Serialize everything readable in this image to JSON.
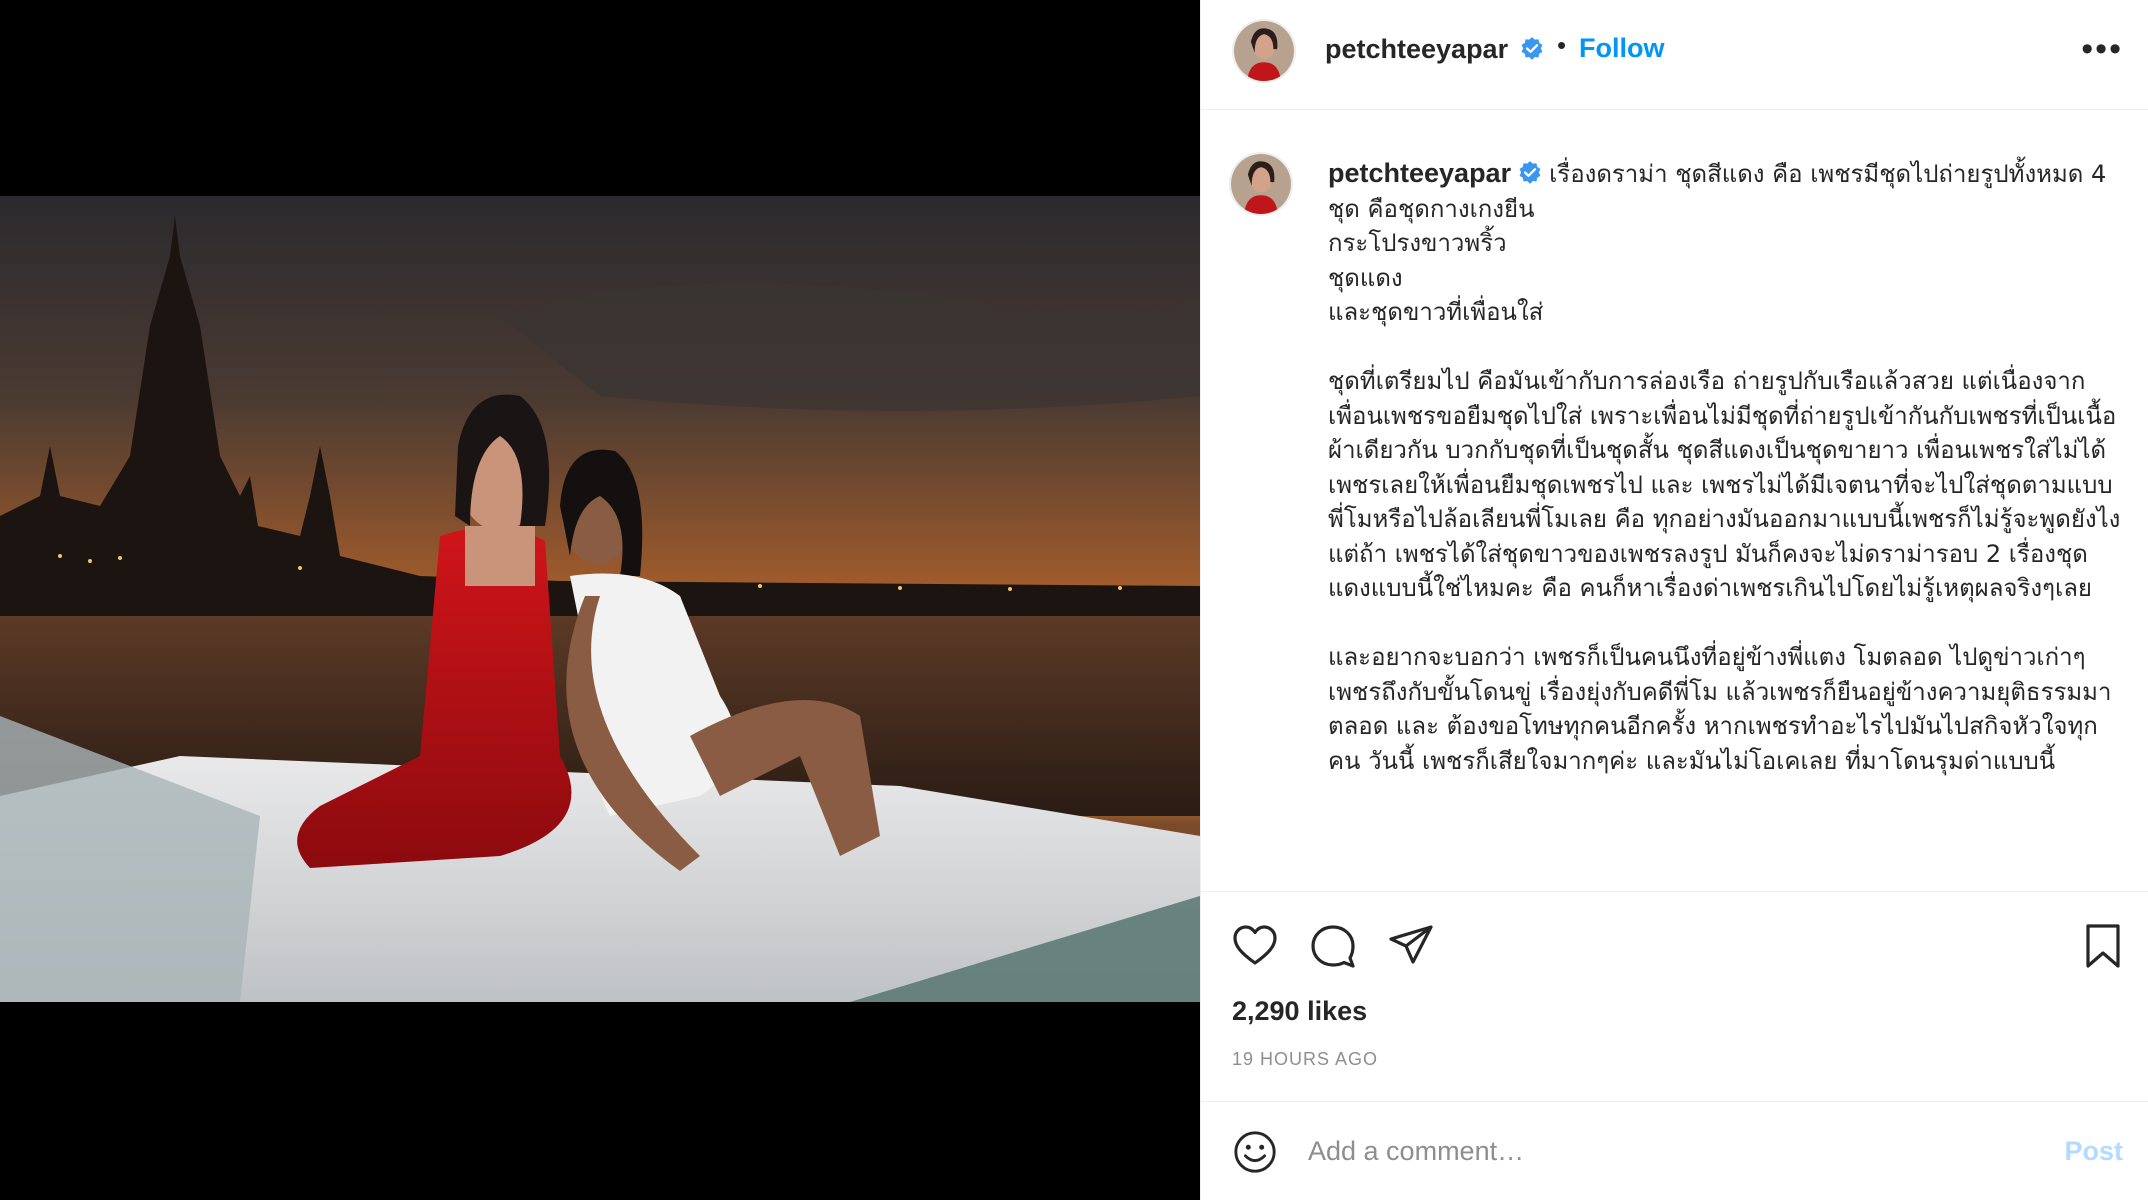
{
  "post": {
    "username": "petchteeyapar",
    "follow_label": "Follow",
    "separator": "•",
    "more_label": "•••",
    "caption": "เรื่องดราม่า ชุดสีแดง คือ เพชรมีชุดไปถ่ายรูปทั้งหมด 4 ชุด คือชุดกางเกงยีน\nกระโปรงขาวพริ้ว\nชุดแดง\nและชุดขาวที่เพื่อนใส่\n\nชุดที่เตรียมไป คือมันเข้ากับการล่องเรือ ถ่ายรูปกับเรือแล้วสวย แต่เนื่องจากเพื่อนเพชรขอยืมชุดไปใส่ เพราะเพื่อนไม่มีชุดที่ถ่ายรูปเข้ากันกับเพชรที่เป็นเนื้อผ้าเดียวกัน บวกกับชุดที่เป็นชุดสั้น ชุดสีแดงเป็นชุดขายาว เพื่อนเพชรใส่ไม่ได้ เพชรเลยให้เพื่อนยืมชุดเพชรไป และ เพชรไม่ได้มีเจตนาที่จะไปใส่ชุดตามแบบพี่โมหรือไปล้อเลียนพี่โมเลย คือ ทุกอย่างมันออกมาแบบนี้เพชรก็ไม่รู้จะพูดยังไง แต่ถ้า เพชรได้ใส่ชุดขาวของเพชรลงรูป มันก็คงจะไม่ดราม่ารอบ 2 เรื่องชุดแดงแบบนี้ใช่ไหมคะ คือ คนก็หาเรื่องด่าเพชรเกินไปโดยไม่รู้เหตุผลจริงๆเลย\n\nและอยากจะบอกว่า เพชรก็เป็นคนนึงที่อยู่ข้างพี่แตง โมตลอด ไปดูข่าวเก่าๆ เพชรถึงกับขั้นโดนขู่ เรื่องยุ่งกับคดีพี่โม แล้วเพชรก็ยืนอยู่ข้างความยุติธรรมมาตลอด และ ต้องขอโทษทุกคนอีกครั้ง หากเพชรทำอะไรไปมันไปสกิจหัวใจทุกคน วันนี้ เพชรก็เสียใจมากๆค่ะ และมันไม่โอเคเลย ที่มาโดนรุมด่าแบบนี้",
    "likes": "2,290 likes",
    "time_ago": "19 HOURS AGO"
  },
  "comment": {
    "placeholder": "Add a comment…",
    "post_label": "Post"
  },
  "icons": {
    "like": "heart-icon",
    "comment": "comment-icon",
    "share": "paper-plane-icon",
    "save": "bookmark-icon",
    "emoji": "smiley-icon",
    "verified": "verified-badge-icon"
  },
  "colors": {
    "accent": "#0095f6",
    "verified": "#3897f0",
    "muted": "#8e8e8e",
    "post_disabled": "#b3dbff"
  }
}
